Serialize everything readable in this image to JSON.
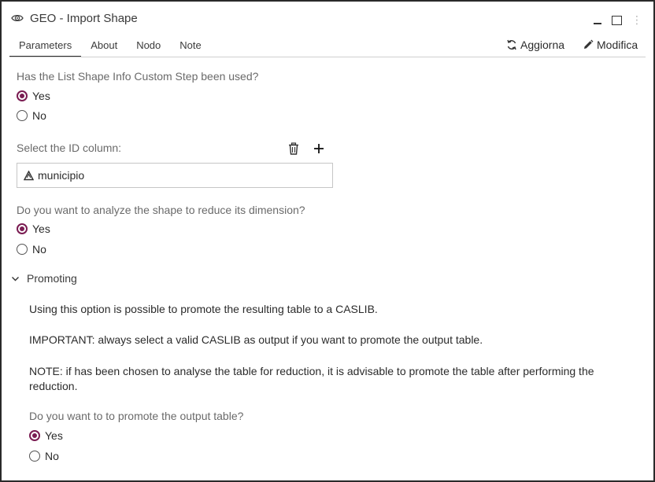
{
  "window": {
    "title": "GEO - Import Shape",
    "title_icon": "view-eye-icon",
    "more_glyph": "⋮"
  },
  "tabs": [
    {
      "label": "Parameters",
      "active": true
    },
    {
      "label": "About"
    },
    {
      "label": "Nodo"
    },
    {
      "label": "Note"
    }
  ],
  "actions": {
    "refresh_label": "Aggiorna",
    "edit_label": "Modifica"
  },
  "form": {
    "q1": {
      "label": "Has the List Shape Info Custom Step been used?",
      "options": [
        "Yes",
        "No"
      ],
      "selected": "Yes"
    },
    "id_column": {
      "label": "Select the ID column:",
      "value": "municipio"
    },
    "q2": {
      "label": "Do you want to analyze the shape to reduce its dimension?",
      "options": [
        "Yes",
        "No"
      ],
      "selected": "Yes"
    }
  },
  "promoting": {
    "title": "Promoting",
    "expanded": true,
    "text1": "Using this option is possible to promote the resulting table to a CASLIB.",
    "text2": "IMPORTANT: always select a valid CASLIB as output if you want to promote the output table.",
    "text3": "NOTE: if has been chosen to analyse the table for reduction, it is advisable to promote the table after performing the reduction.",
    "q3": {
      "label": "Do you want to to promote the output table?",
      "options": [
        "Yes",
        "No"
      ],
      "selected": "Yes"
    }
  },
  "colors": {
    "accent": "#7a1c52",
    "label_gray": "#6a6a6a",
    "border": "#c6c6c6"
  }
}
